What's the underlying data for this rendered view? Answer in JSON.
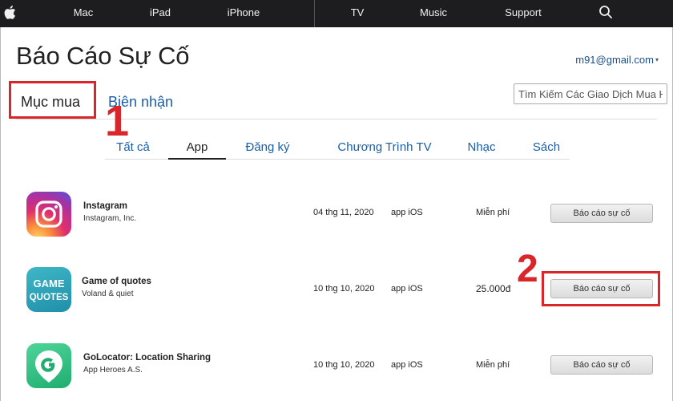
{
  "nav": {
    "items": [
      "Mac",
      "iPad",
      "iPhone",
      "TV",
      "Music",
      "Support"
    ],
    "icons": {
      "logo": "apple-icon",
      "search": "search-icon"
    }
  },
  "page": {
    "title": "Báo Cáo Sự Cố",
    "account": "m91@gmail.com",
    "account_caret": "▾"
  },
  "tabs": {
    "purchases": "Mục mua",
    "receipts": "Biên nhận"
  },
  "search": {
    "placeholder": "Tìm Kiếm Các Giao Dịch Mua Hàng"
  },
  "categories": [
    "Tất cả",
    "App",
    "Đăng ký",
    "Chương Trình TV",
    "Nhạc",
    "Sách"
  ],
  "active_category": "App",
  "annotations": {
    "step1": "1",
    "step2": "2"
  },
  "purchases": [
    {
      "name": "Instagram",
      "developer": "Instagram, Inc.",
      "date": "04 thg 11, 2020",
      "type": "app iOS",
      "price": "Miễn phí",
      "action": "Báo cáo sự cố"
    },
    {
      "name": "Game of quotes",
      "developer": "Voland & quiet",
      "date": "10 thg 10, 2020",
      "type": "app iOS",
      "price": "25.000đ",
      "action": "Báo cáo sự cố",
      "icon_text": [
        "GAME",
        "QUOTES"
      ]
    },
    {
      "name": "GoLocator: Location Sharing",
      "developer": "App Heroes A.S.",
      "date": "10 thg 10, 2020",
      "type": "app iOS",
      "price": "Miễn phí",
      "action": "Báo cáo sự cố"
    }
  ],
  "colors": {
    "nav_bg": "#1d1d1f",
    "link": "#1a5ea8",
    "highlight": "#d9262b"
  }
}
